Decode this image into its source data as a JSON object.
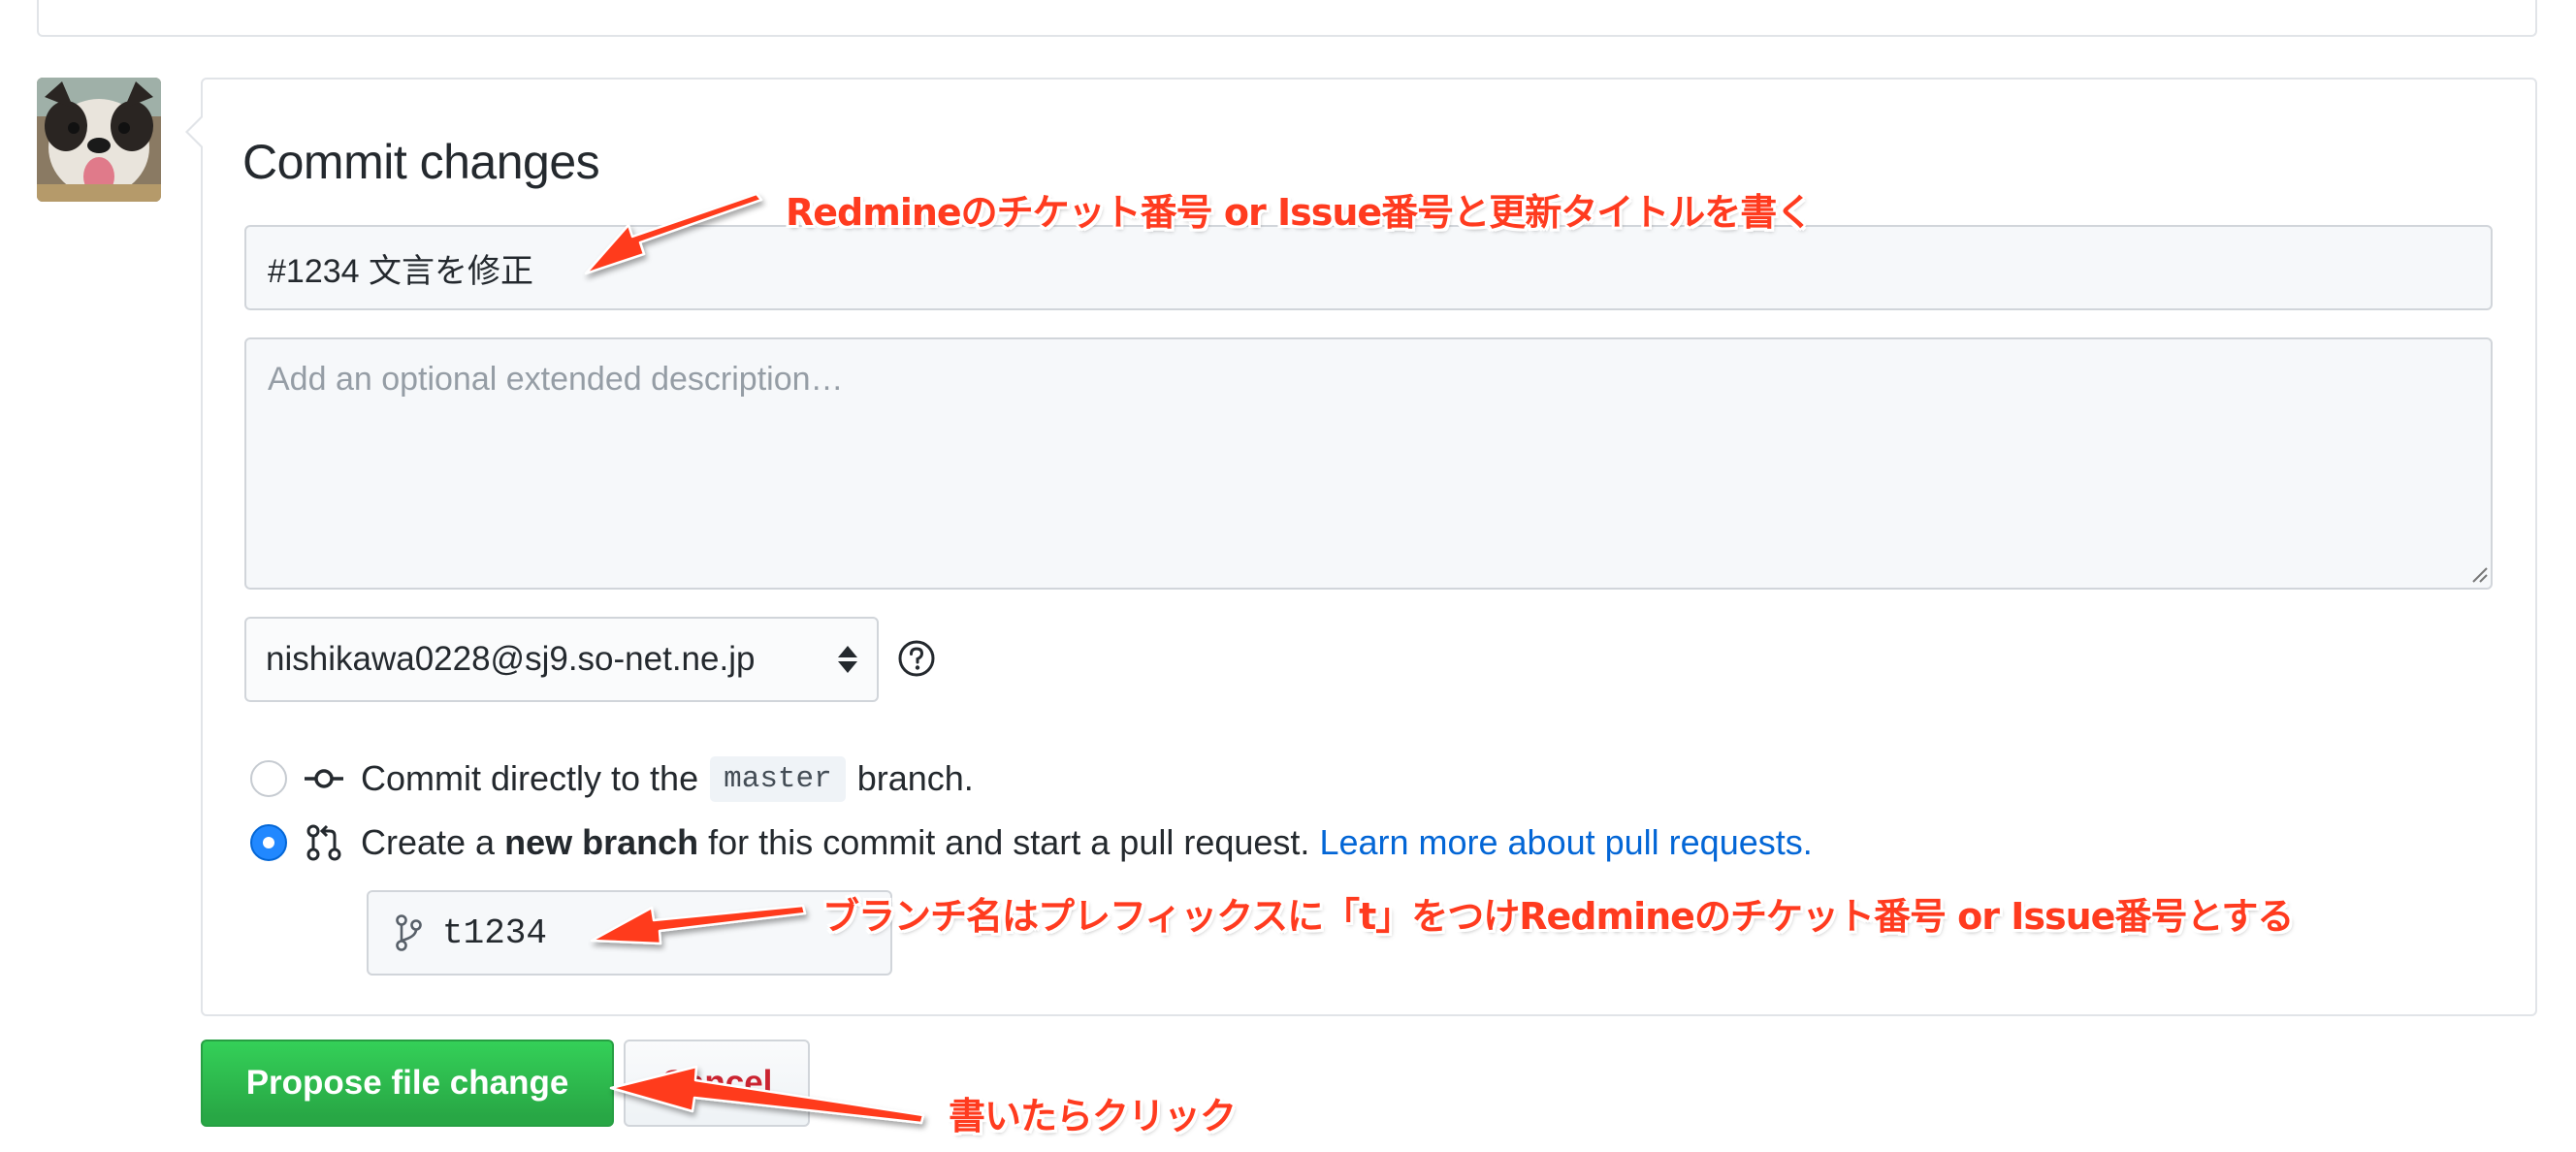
{
  "commit_form": {
    "title": "Commit changes",
    "summary_value": "#1234 文言を修正",
    "description_placeholder": "Add an optional extended description…",
    "author_email": "nishikawa0228@sj9.so-net.ne.jp",
    "option_direct": {
      "prefix": "Commit directly to the",
      "branch": "master",
      "suffix": "branch."
    },
    "option_new_branch": {
      "prefix": "Create a",
      "bold": "new branch",
      "suffix": "for this commit and start a pull request.",
      "link": "Learn more about pull requests."
    },
    "selected_option": "new_branch",
    "branch_name_value": "t1234",
    "propose_label": "Propose file change",
    "cancel_label": "Cancel"
  },
  "annotations": {
    "title_note": "Redmineのチケット番号 or Issue番号と更新タイトルを書く",
    "branch_note": "ブランチ名はプレフィックスに「t」をつけRedmineのチケット番号 or Issue番号とする",
    "click_note": "書いたらクリック"
  },
  "colors": {
    "primary_button": "#2ea44f",
    "link": "#0366d6",
    "cancel_text": "#cb2431",
    "annotation": "#ff3b1f"
  }
}
